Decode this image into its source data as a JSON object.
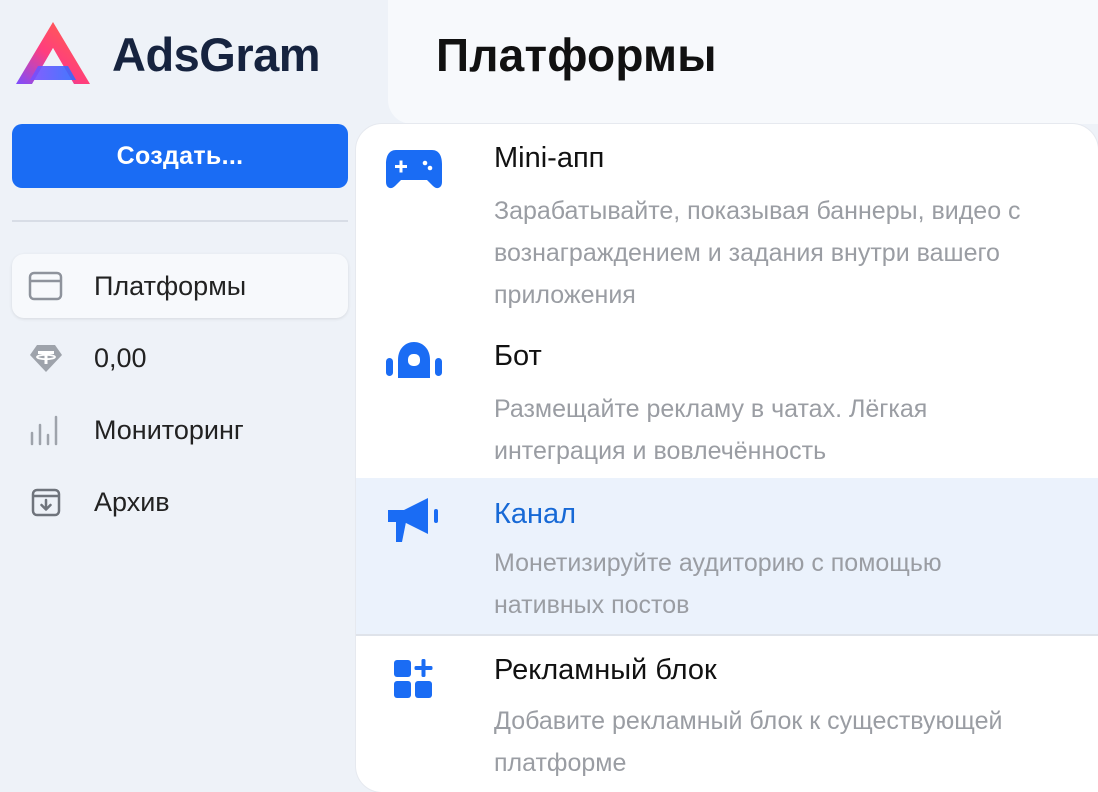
{
  "brand": {
    "name": "AdsGram"
  },
  "sidebar": {
    "create_label": "Создать...",
    "items": [
      {
        "label": "Платформы",
        "icon": "window-icon",
        "active": true
      },
      {
        "label": "0,00",
        "icon": "tether-icon",
        "active": false
      },
      {
        "label": "Мониторинг",
        "icon": "bar-chart-icon",
        "active": false
      },
      {
        "label": "Архив",
        "icon": "archive-icon",
        "active": false
      }
    ]
  },
  "header": {
    "title": "Платформы"
  },
  "platforms": [
    {
      "title": "Mini-апп",
      "description": "Зарабатывайте, показывая баннеры, видео с вознаграждением и задания внутри вашего приложения",
      "icon": "gamepad-icon"
    },
    {
      "title": "Бот",
      "description": "Размещайте рекламу в чатах. Лёгкая интеграция и вовлечённость",
      "icon": "robot-icon"
    },
    {
      "title": "Канал",
      "description": "Монетизируйте аудиторию с помощью нативных постов",
      "icon": "megaphone-icon",
      "selected": true
    },
    {
      "title": "Рекламный блок",
      "description": "Добавите рекламный блок к существующей платформе",
      "icon": "add-block-icon"
    }
  ],
  "colors": {
    "accent": "#1a6cf4",
    "selected_bg": "#ebf2fc",
    "logo_gradient": [
      "#ff3d7f",
      "#7b4dff",
      "#2f6bff"
    ]
  }
}
